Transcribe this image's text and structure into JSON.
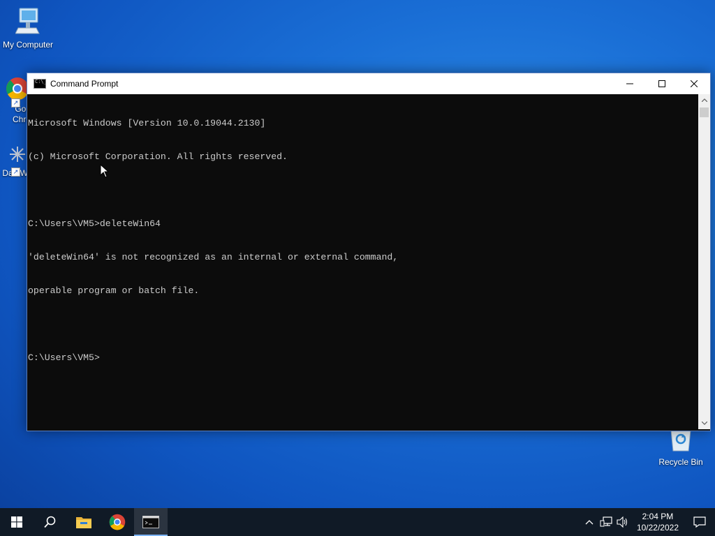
{
  "desktop": {
    "icons": [
      {
        "label": "My Computer",
        "icon": "computer-icon"
      },
      {
        "label": "Goo\nChro",
        "icon": "chrome-icon"
      },
      {
        "label": "DataW",
        "icon": "datawin-icon"
      },
      {
        "label": "Recycle Bin",
        "icon": "recycle-bin-icon"
      }
    ]
  },
  "window": {
    "title": "Command Prompt",
    "controls": {
      "minimize": "—",
      "maximize": "☐",
      "close": "✕"
    }
  },
  "console": {
    "lines": [
      "Microsoft Windows [Version 10.0.19044.2130]",
      "(c) Microsoft Corporation. All rights reserved.",
      "",
      "C:\\Users\\VM5>deleteWin64",
      "'deleteWin64' is not recognized as an internal or external command,",
      "operable program or batch file.",
      "",
      "C:\\Users\\VM5>"
    ]
  },
  "taskbar": {
    "buttons": [
      {
        "name": "start",
        "icon": "windows-logo-icon"
      },
      {
        "name": "search",
        "icon": "search-icon"
      },
      {
        "name": "file-explorer",
        "icon": "folder-icon"
      },
      {
        "name": "chrome",
        "icon": "chrome-icon"
      },
      {
        "name": "command-prompt",
        "icon": "cmd-icon",
        "active": true
      }
    ],
    "tray": {
      "time": "2:04 PM",
      "date": "10/22/2022"
    }
  },
  "colors": {
    "desktop_bg": "#1a6fd6",
    "console_bg": "#0c0c0c",
    "console_fg": "#cccccc",
    "taskbar_bg": "#101a26"
  }
}
